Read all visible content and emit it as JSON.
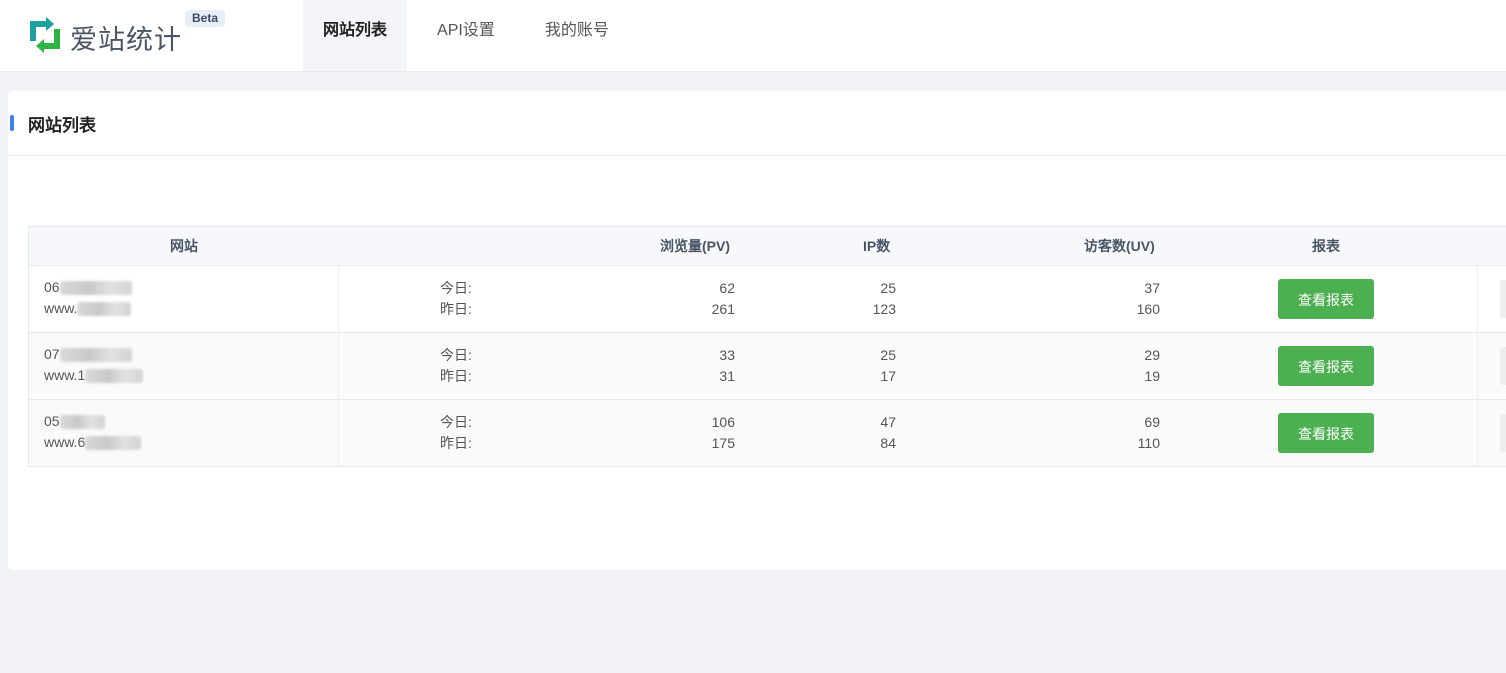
{
  "app": {
    "name": "爱站统计",
    "beta": "Beta"
  },
  "nav": [
    {
      "label": "网站列表",
      "active": true
    },
    {
      "label": "API设置",
      "active": false
    },
    {
      "label": "我的账号",
      "active": false
    }
  ],
  "panel": {
    "title": "网站列表"
  },
  "table": {
    "headers": {
      "site": "网站",
      "pv": "浏览量(PV)",
      "ip": "IP数",
      "uv": "访客数(UV)",
      "report": "报表"
    },
    "labels": {
      "today": "今日:",
      "yesterday": "昨日:"
    },
    "button_label": "查看报表",
    "rows": [
      {
        "site_name_prefix": "06",
        "site_url_prefix": "www.",
        "pv_today": "62",
        "pv_yesterday": "261",
        "ip_today": "25",
        "ip_yesterday": "123",
        "uv_today": "37",
        "uv_yesterday": "160"
      },
      {
        "site_name_prefix": "07",
        "site_url_prefix": "www.1",
        "pv_today": "33",
        "pv_yesterday": "31",
        "ip_today": "25",
        "ip_yesterday": "17",
        "uv_today": "29",
        "uv_yesterday": "19"
      },
      {
        "site_name_prefix": "05",
        "site_url_prefix": "www.6",
        "pv_today": "106",
        "pv_yesterday": "175",
        "ip_today": "47",
        "ip_yesterday": "84",
        "uv_today": "69",
        "uv_yesterday": "110"
      }
    ]
  },
  "colors": {
    "accent": "#3b82f6",
    "button": "#4caf50",
    "logo_teal": "#1e9fa0",
    "logo_green": "#2fb344"
  }
}
